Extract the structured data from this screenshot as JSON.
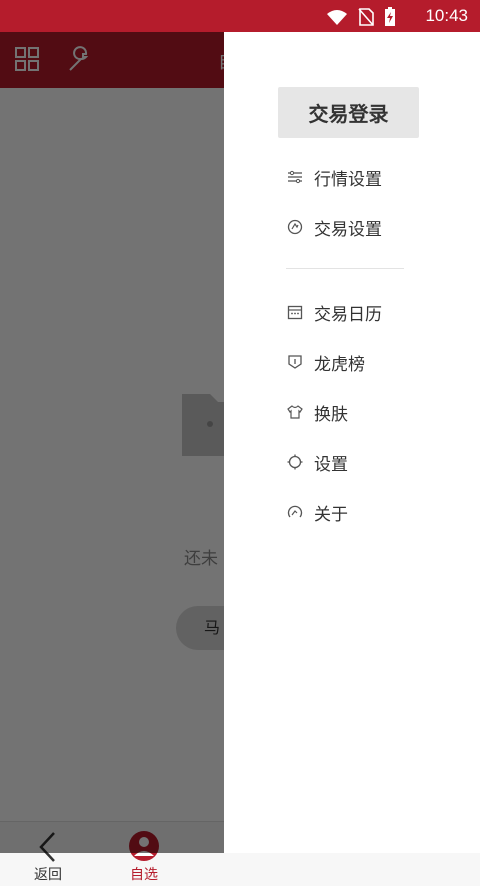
{
  "status_bar": {
    "time": "10:43",
    "icons": [
      "wifi-icon",
      "no-sim-icon",
      "battery-charging-icon"
    ]
  },
  "app_bar": {
    "icons": [
      "grid-icon",
      "wrench-icon"
    ],
    "partial_title": "自"
  },
  "empty_state": {
    "message": "还未",
    "action_label": "马"
  },
  "bottom_nav": {
    "items": [
      {
        "label": "返回",
        "icon": "back-arrow-icon"
      },
      {
        "label": "自选",
        "icon": "user-icon",
        "active": true
      }
    ]
  },
  "drawer": {
    "login_label": "交易登录",
    "group1": [
      {
        "label": "行情设置",
        "icon": "sliders-icon"
      },
      {
        "label": "交易设置",
        "icon": "trade-settings-icon"
      }
    ],
    "group2": [
      {
        "label": "交易日历",
        "icon": "calendar-icon"
      },
      {
        "label": "龙虎榜",
        "icon": "ranking-icon"
      },
      {
        "label": "换肤",
        "icon": "shirt-icon"
      },
      {
        "label": "设置",
        "icon": "gear-icon"
      },
      {
        "label": "关于",
        "icon": "about-icon"
      }
    ]
  },
  "colors": {
    "brand": "#b51c2c",
    "overlay": "rgba(0,0,0,0.55)",
    "text": "#333333"
  }
}
